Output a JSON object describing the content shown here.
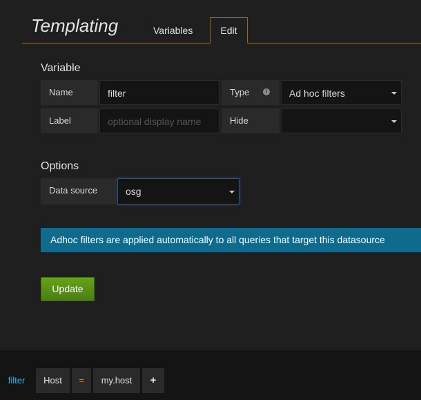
{
  "header": {
    "title": "Templating",
    "tabs": [
      {
        "label": "Variables",
        "active": false
      },
      {
        "label": "Edit",
        "active": true
      }
    ]
  },
  "variable": {
    "section_title": "Variable",
    "name_label": "Name",
    "name_value": "filter",
    "type_label": "Type",
    "type_info_icon": "info-icon",
    "type_value": "Ad hoc filters",
    "label_label": "Label",
    "label_placeholder": "optional display name",
    "hide_label": "Hide",
    "hide_value": ""
  },
  "options": {
    "section_title": "Options",
    "datasource_label": "Data source",
    "datasource_value": "osg"
  },
  "banner": {
    "text": "Adhoc filters are applied automatically to all queries that target this datasource",
    "color": "#0e6b8e"
  },
  "actions": {
    "update_label": "Update"
  },
  "adhoc_bar": {
    "variable": "filter",
    "key": "Host",
    "operator": "=",
    "value": "my.host",
    "add": "+"
  },
  "colors": {
    "accent_border": "#8a6d3b",
    "variable_name": "#33b5e5",
    "operator": "#eb7b18",
    "update_button": "#5a9216"
  }
}
